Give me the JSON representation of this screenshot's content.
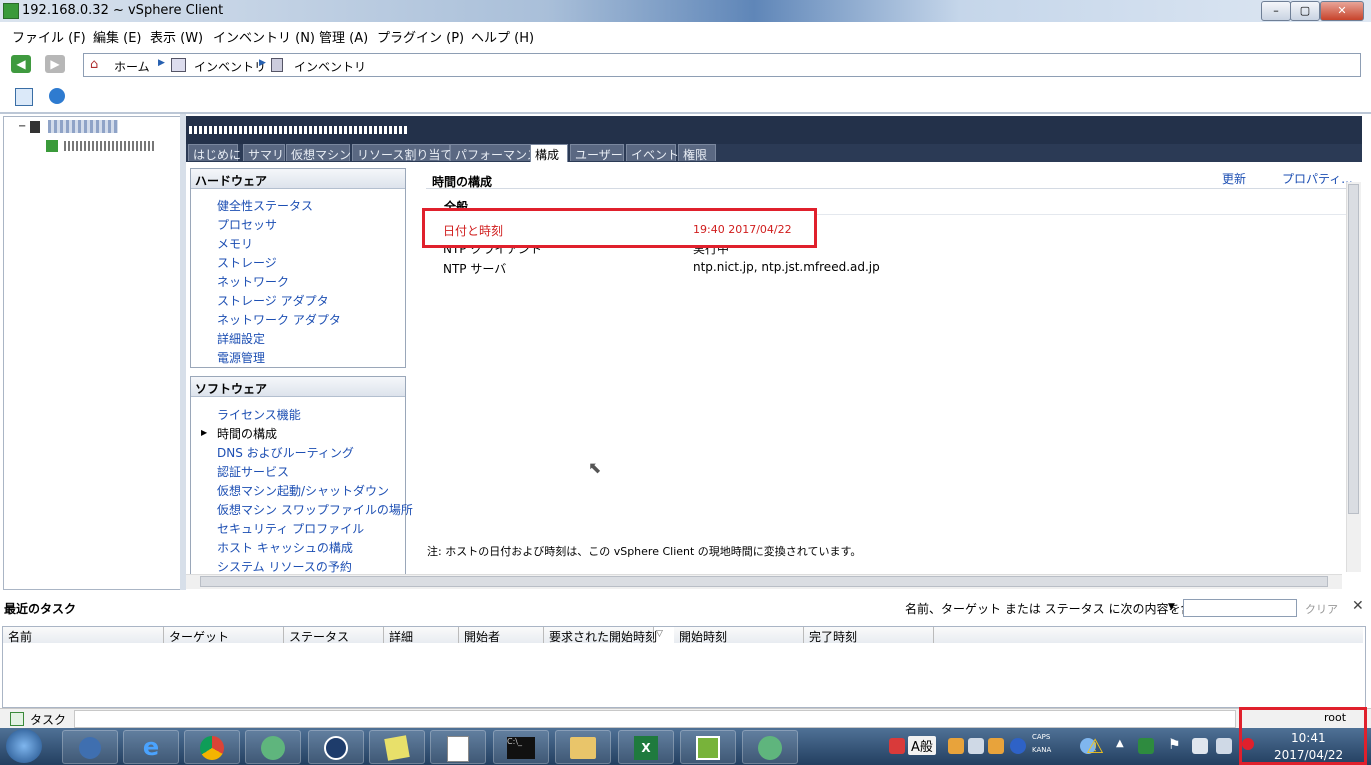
{
  "window": {
    "title": "192.168.0.32 ~ vSphere Client"
  },
  "menu": [
    "ファイル (F)",
    "編集 (E)",
    "表示 (W)",
    "インベントリ (N)",
    "管理 (A)",
    "プラグイン (P)",
    "ヘルプ (H)"
  ],
  "breadcrumb": {
    "home": "ホーム",
    "inventory1": "インベントリ",
    "inventory2": "インベントリ"
  },
  "tabs": [
    "はじめに",
    "サマリ",
    "仮想マシン",
    "リソース割り当て",
    "パフォーマンス",
    "構成",
    "ユーザー",
    "イベント",
    "権限"
  ],
  "hardware": {
    "header": "ハードウェア",
    "items": [
      "健全性ステータス",
      "プロセッサ",
      "メモリ",
      "ストレージ",
      "ネットワーク",
      "ストレージ アダプタ",
      "ネットワーク アダプタ",
      "詳細設定",
      "電源管理"
    ]
  },
  "software": {
    "header": "ソフトウェア",
    "items": [
      "ライセンス機能",
      "時間の構成",
      "DNS およびルーティング",
      "認証サービス",
      "仮想マシン起動/シャットダウン",
      "仮想マシン スワップファイルの場所",
      "セキュリティ プロファイル",
      "ホスト キャッシュの構成",
      "システム リソースの予約"
    ],
    "active_index": 1
  },
  "time_config": {
    "title": "時間の構成",
    "refresh": "更新",
    "properties": "プロパティ...",
    "section": "全般",
    "rows": [
      {
        "label": "日付と時刻",
        "value": "19:40  2017/04/22"
      },
      {
        "label": "NTP クライアント",
        "value": "実行中"
      },
      {
        "label": "NTP サーバ",
        "value": "ntp.nict.jp,  ntp.jst.mfreed.ad.jp"
      }
    ],
    "note": "注: ホストの日付および時刻は、この vSphere Client の現地時間に変換されています。"
  },
  "tasks": {
    "title": "最近のタスク",
    "filter_label": "名前、ターゲット または ステータス に次の内容を含む:",
    "clear": "クリア",
    "columns": [
      "名前",
      "ターゲット",
      "ステータス",
      "詳細",
      "開始者",
      "要求された開始時刻",
      "開始時刻",
      "完了時刻"
    ]
  },
  "statusbar": {
    "tasks_label": "タスク",
    "user": "root"
  },
  "taskbar": {
    "time": "10:41",
    "date": "2017/04/22",
    "ime": "A般",
    "caps": "CAPS",
    "kana": "KANA"
  },
  "colors": {
    "accent": "#e0202c",
    "link": "#1d4fb3"
  }
}
